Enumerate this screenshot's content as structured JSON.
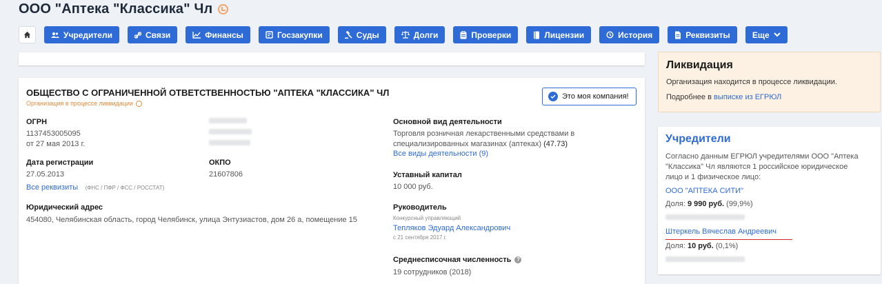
{
  "page": {
    "title": "ООО \"Аптека \"Классика\" Чл"
  },
  "tabs": [
    {
      "label": "Учредители",
      "icon": "users-icon"
    },
    {
      "label": "Связи",
      "icon": "link-icon"
    },
    {
      "label": "Финансы",
      "icon": "chart-icon"
    },
    {
      "label": "Госзакупки",
      "icon": "contract-icon"
    },
    {
      "label": "Суды",
      "icon": "gavel-icon"
    },
    {
      "label": "Долги",
      "icon": "scales-icon"
    },
    {
      "label": "Проверки",
      "icon": "clipboard-icon"
    },
    {
      "label": "Лицензии",
      "icon": "book-icon"
    },
    {
      "label": "История",
      "icon": "history-icon"
    },
    {
      "label": "Реквизиты",
      "icon": "document-icon"
    },
    {
      "label": "Еще",
      "icon": "chevron-down-icon"
    }
  ],
  "company": {
    "full_name": "ОБЩЕСТВО С ОГРАНИЧЕННОЙ ОТВЕТСТВЕННОСТЬЮ \"АПТЕКА \"КЛАССИКА\" ЧЛ",
    "status": "Организация в процессе ликвидации",
    "mine_button": "Это моя компания!",
    "ogrn_label": "ОГРН",
    "ogrn_value": "1137453005095",
    "ogrn_date": "от 27 мая 2013 г.",
    "reg_label": "Дата регистрации",
    "reg_value": "27.05.2013",
    "all_requisites": "Все реквизиты",
    "requisites_note": "(ФНС / ПФР / ФСС / РОССТАТ)",
    "okpo_label": "ОКПО",
    "okpo_value": "21607806",
    "address_label": "Юридический адрес",
    "address_value": "454080, Челябинская область, город Челябинск, улица Энтузиастов, дом 26 а, помещение 15",
    "activity_label": "Основной вид деятельности",
    "activity_value": "Торговля розничная лекарственными средствами в специализированных магазинах (аптеках)",
    "activity_code": "(47.73)",
    "activity_link": "Все виды деятельности (9)",
    "capital_label": "Уставный капитал",
    "capital_value": "10 000 руб.",
    "head_label": "Руководитель",
    "head_role": "Конкурсный управляющий",
    "head_name": "Тепляков Эдуард Александрович",
    "head_since": "с 21 сентября 2017 г.",
    "staff_label": "Среднесписочная численность",
    "staff_value": "19 сотрудников (2018)"
  },
  "liquidation": {
    "title": "Ликвидация",
    "text": "Организация находится в процессе ликвидации.",
    "more_prefix": "Подробнее в",
    "more_link": "выписке из ЕГРЮЛ"
  },
  "founders": {
    "title": "Учредители",
    "description": "Согласно данным ЕГРЮЛ учредителями ООО \"Аптека \"Классика\" Чл являются 1 российское юридическое лицо и 1 физическое лицо:",
    "items": [
      {
        "name": "ООО \"АПТЕКА СИТИ\"",
        "share_label": "Доля:",
        "share_value": "9 990 руб.",
        "share_pct": "(99,9%)"
      },
      {
        "name": "Штеркель Вячеслав Андреевич",
        "share_label": "Доля:",
        "share_value": "10 руб.",
        "share_pct": "(0,1%)"
      }
    ]
  },
  "colors": {
    "accent": "#2e6bd6",
    "warning": "#e08a3c"
  }
}
